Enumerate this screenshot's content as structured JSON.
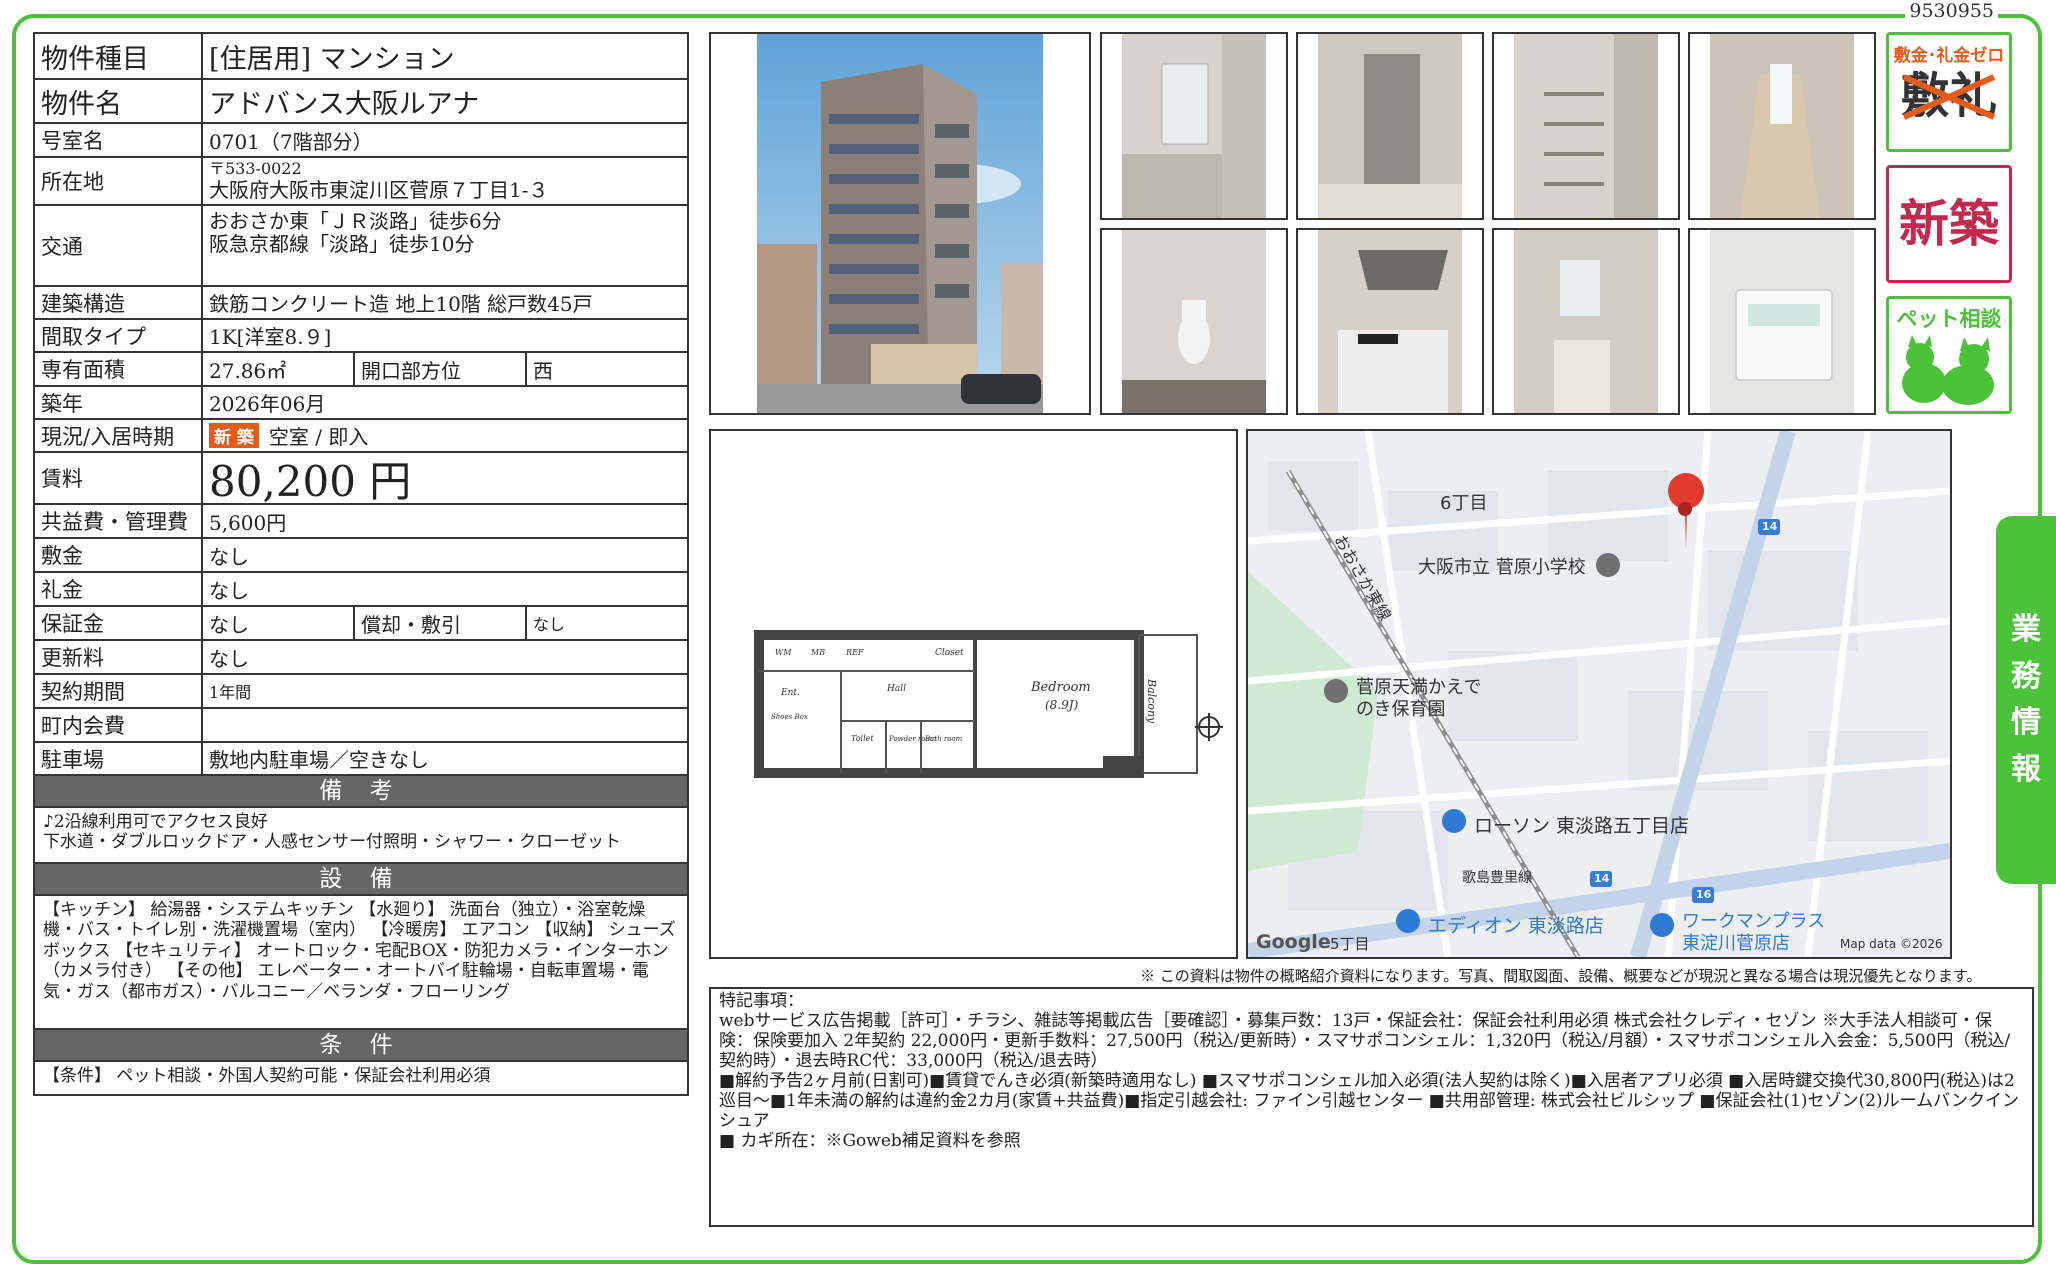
{
  "doc_id": "9530955",
  "property": {
    "type_label": "物件種目",
    "type_value": "[住居用]  マンション",
    "name_label": "物件名",
    "name_value": "アドバンス大阪ルアナ",
    "room_label": "号室名",
    "room_value": "0701（7階部分）",
    "address_label": "所在地",
    "postal": "〒533-0022",
    "address": "大阪府大阪市東淀川区菅原７丁目1-３",
    "transport_label": "交通",
    "transport_1": "おおさか東「ＪＲ淡路」徒歩6分",
    "transport_2": "阪急京都線「淡路」徒歩10分",
    "structure_label": "建築構造",
    "structure_value": "鉄筋コンクリート造  地上10階  総戸数45戸",
    "layout_label": "間取タイプ",
    "layout_value": "1K[洋室8.９]",
    "area_label": "専有面積",
    "area_value": "27.86㎡",
    "direction_label": "開口部方位",
    "direction_value": "西",
    "built_label": "築年",
    "built_value": "2026年06月",
    "status_label": "現況/入居時期",
    "status_badge": "新 築",
    "status_value": "空室 / 即入",
    "rent_label": "賃料",
    "rent_value": "80,200 円",
    "fee_label": "共益費・管理費",
    "fee_value": "5,600円",
    "deposit_label": "敷金",
    "deposit_value": "なし",
    "key_money_label": "礼金",
    "key_money_value": "なし",
    "guarantee_label": "保証金",
    "guarantee_value": "なし",
    "amort_label": "償却・敷引",
    "amort_value": "なし",
    "renewal_label": "更新料",
    "renewal_value": "なし",
    "contract_label": "契約期間",
    "contract_value": "1年間",
    "town_label": "町内会費",
    "town_value": "",
    "parking_label": "駐車場",
    "parking_value": "敷地内駐車場／空きなし"
  },
  "remarks": {
    "title": "備 考",
    "line1": "♪2沿線利用可でアクセス良好",
    "line2": "下水道・ダブルロックドア・人感センサー付照明・シャワー・クローゼット"
  },
  "facilities": {
    "title": "設 備",
    "text": "【キッチン】 給湯器・システムキッチン 【水廻り】 洗面台（独立）・浴室乾燥機・バス・トイレ別・洗濯機置場（室内） 【冷暖房】 エアコン 【収納】 シューズボックス 【セキュリティ】 オートロック・宅配BOX・防犯カメラ・インターホン（カメラ付き） 【その他】 エレベーター・オートバイ駐輪場・自転車置場・電気・ガス（都市ガス）・バルコニー／ベランダ・フローリング"
  },
  "conditions": {
    "title": "条 件",
    "text": "【条件】 ペット相談・外国人契約可能・保証会社利用必須"
  },
  "badges": {
    "zero_title": "敷金･礼金ゼロ",
    "zero_chars": "敷礼",
    "new_build": "新築",
    "pet_title": "ペット相談"
  },
  "floorplan": {
    "bedroom": "Bedroom",
    "bedroom_size": "(8.9J)",
    "balcony": "Balcony",
    "closet": "Closet",
    "hall": "Hall",
    "entrance": "Ent.",
    "toilet": "Toilet",
    "powder": "Powder room",
    "bath": "Bath room",
    "shoes": "Shoes Box",
    "wm": "WM",
    "mb": "MB",
    "ref": "REF"
  },
  "map": {
    "area_label": "6丁目",
    "school": "大阪市立 菅原小学校",
    "nursery_1": "菅原天満かえで",
    "nursery_2": "のき保育園",
    "rail": "おおさか東線",
    "lawson": "ローソン 東淡路五丁目店",
    "road": "歌島豊里線",
    "edion": "エディオン 東淡路店",
    "workman_1": "ワークマンプラス",
    "workman_2": "東淀川菅原店",
    "google": "Google",
    "chome5": "5丁目",
    "mapdata": "Map data ©2026",
    "route14": "14",
    "route16": "16"
  },
  "notice": "※ この資料は物件の概略紹介資料になります。写真、間取図面、設備、概要などが現況と異なる場合は現況優先となります。",
  "special": {
    "title": "特記事項：",
    "line1": "webサービス広告掲載［許可］・チラシ、雑誌等掲載広告［要確認］・募集戸数：13戸・保証会社：保証会社利用必須 株式会社クレディ・セゾン  ※大手法人相談可・保険：保険要加入 2年契約 22,000円・更新手数料：27,500円（税込/更新時）・スマサポコンシェル：1,320円（税込/月額）・スマサポコンシェル入会金：5,500円（税込/契約時）・退去時RC代：33,000円（税込/退去時）",
    "line2": "■解約予告2ヶ月前(日割可)■賃貸でんき必須(新築時適用なし)  ■スマサポコンシェル加入必須(法人契約は除く)■入居者アプリ必須  ■入居時鍵交換代30,800円(税込)は2巡目～■1年未満の解約は違約金2カ月(家賃+共益費)■指定引越会社: ファイン引越センター  ■共用部管理: 株式会社ビルシップ  ■保証会社(1)セゾン(2)ルームバンクインシュア",
    "line3": "■ カギ所在：※Goweb補足資料を参照"
  },
  "side_tab": [
    "業",
    "務",
    "情",
    "報"
  ]
}
